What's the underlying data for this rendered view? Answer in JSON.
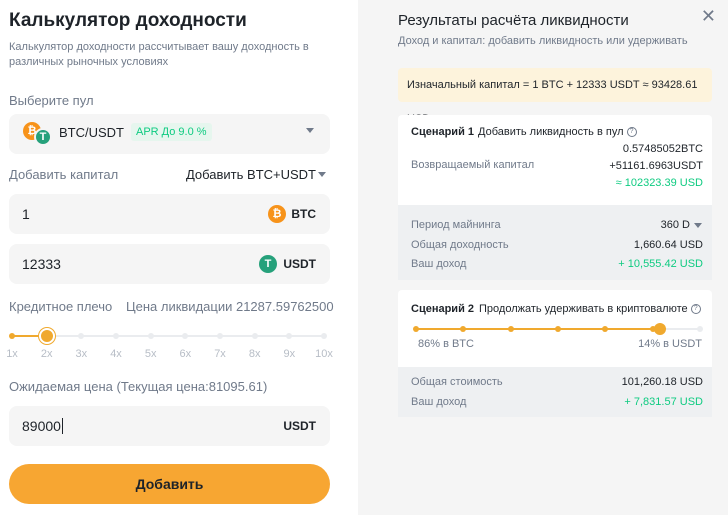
{
  "calculator": {
    "title": "Калькулятор доходности",
    "subtitle": "Калькулятор доходности рассчитывает вашу доходность в различных рыночных условиях",
    "pool_label": "Выберите пул",
    "pool": {
      "pair": "BTC/USDT",
      "apr": "APR До 9.0 %"
    },
    "add_capital_label": "Добавить капитал",
    "add_mode": "Добавить BTC+USDT",
    "btc_input": {
      "value": "1",
      "unit": "BTC"
    },
    "usdt_input": {
      "value": "12333",
      "unit": "USDT"
    },
    "leverage_label": "Кредитное плечо",
    "liquidation_price": "Цена ликвидации 21287.59762500",
    "leverage": {
      "selected": "2x",
      "options": [
        "1x",
        "2x",
        "3x",
        "4x",
        "5x",
        "6x",
        "7x",
        "8x",
        "9x",
        "10x"
      ]
    },
    "expected_price_label": "Ожидаемая цена (Текущая цена:81095.61)",
    "price_input": {
      "value": "89000",
      "unit": "USDT"
    },
    "add_button": "Добавить"
  },
  "results": {
    "title": "Результаты расчёта ликвидности",
    "subtitle": "Доход и капитал: добавить ликвидность или удерживать",
    "initial_capital": "Изначальный капитал = 1 BTC + 12333 USDT ≈ 93428.61 USD",
    "scenario1": {
      "label": "Сценарий 1",
      "name": "Добавить ликвидность в пул",
      "btc_amount": "0.57485052BTC",
      "returned_capital_label": "Возвращаемый капитал",
      "returned_usdt": "+51161.6963USDT",
      "returned_usd": "≈ 102323.39 USD",
      "mining_period_label": "Период майнинга",
      "mining_period": "360 D",
      "total_yield_label": "Общая доходность",
      "total_yield": "1,660.64 USD",
      "income_label": "Ваш доход",
      "income": "+ 10,555.42 USD"
    },
    "scenario2": {
      "label": "Сценарий 2",
      "name": "Продолжать удерживать в криптовалюте",
      "split": {
        "btc_percent": 86,
        "usdt_percent": 14
      },
      "btc_share": "86% в BTC",
      "usdt_share": "14% в USDT",
      "total_value_label": "Общая стоимость",
      "total_value": "101,260.18 USD",
      "income_label": "Ваш доход",
      "income": "+ 7,831.57 USD"
    }
  },
  "colors": {
    "accent": "#f7a632",
    "green": "#0ecb81",
    "btc": "#f7931a",
    "usdt": "#26a17b"
  }
}
